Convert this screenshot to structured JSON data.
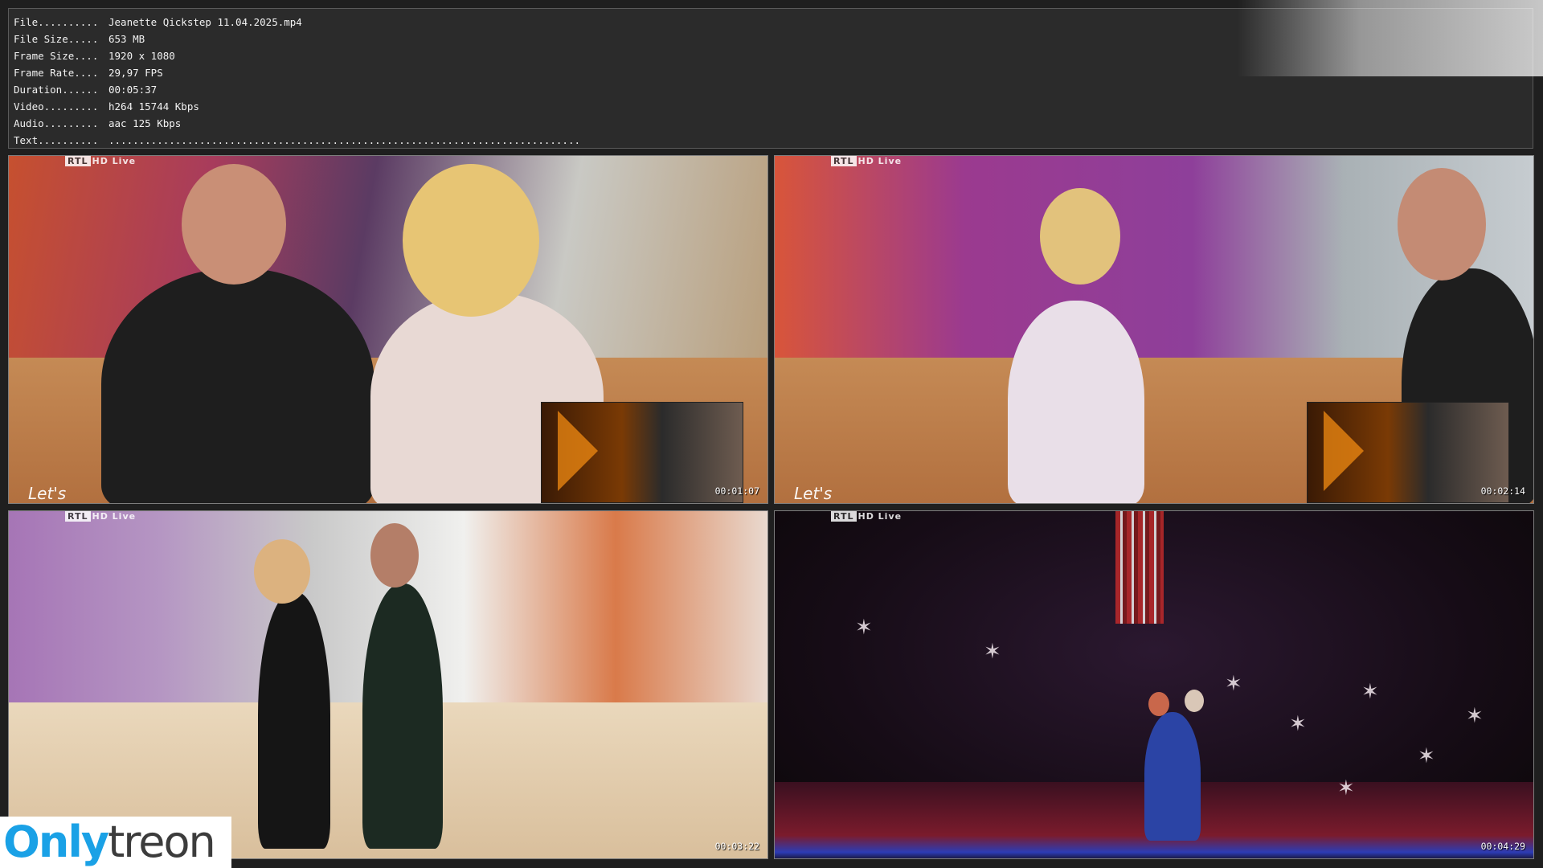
{
  "info": {
    "rows": [
      {
        "label": "File..........",
        "value": "Jeanette Qickstep 11.04.2025.mp4"
      },
      {
        "label": "File Size.....",
        "value": "653 MB"
      },
      {
        "label": "Frame Size....",
        "value": "1920 x 1080"
      },
      {
        "label": "Frame Rate....",
        "value": "29,97 FPS"
      },
      {
        "label": "Duration......",
        "value": "00:05:37"
      },
      {
        "label": "Video.........",
        "value": "h264 15744 Kbps"
      },
      {
        "label": "Audio.........",
        "value": "aac 125 Kbps"
      },
      {
        "label": "Text..........",
        "value": ".............................................................................."
      }
    ]
  },
  "frames": [
    {
      "timestamp": "00:01:07",
      "channel": "RTL",
      "channel_suffix": "HD Live",
      "show": "Let's"
    },
    {
      "timestamp": "00:02:14",
      "channel": "RTL",
      "channel_suffix": "HD Live",
      "show": "Let's"
    },
    {
      "timestamp": "00:03:22",
      "channel": "RTL",
      "channel_suffix": "HD Live"
    },
    {
      "timestamp": "00:04:29",
      "channel": "RTL",
      "channel_suffix": "HD Live"
    }
  ],
  "brand": {
    "part1": "Only",
    "part2": "treon",
    "color_primary": "#1aa1e6",
    "color_secondary": "#3c3c3c"
  }
}
